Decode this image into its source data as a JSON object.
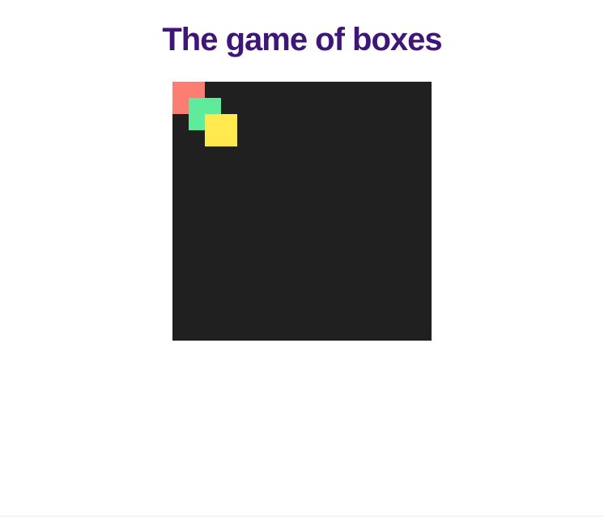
{
  "title": "The game of boxes",
  "board": {
    "background": "#202020"
  },
  "boxes": [
    {
      "color": "#fa7f72"
    },
    {
      "color": "#5eeb9c"
    },
    {
      "color": "#ffe94f"
    }
  ]
}
